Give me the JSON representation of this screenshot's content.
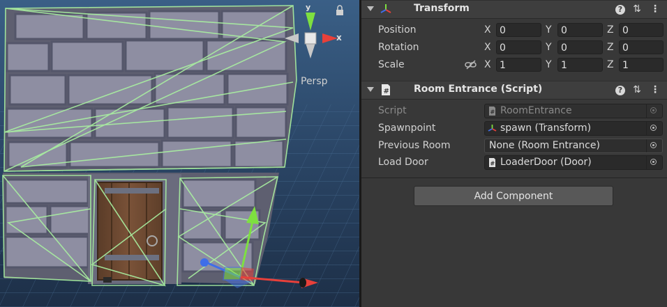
{
  "scene_view": {
    "persp_label": "Persp",
    "gizmo_x_label": "x",
    "gizmo_y_label": "y"
  },
  "transform": {
    "title": "Transform",
    "icon": "transform-axes-icon",
    "position_label": "Position",
    "rotation_label": "Rotation",
    "scale_label": "Scale",
    "axis_x": "X",
    "axis_y": "Y",
    "axis_z": "Z",
    "position": {
      "x": "0",
      "y": "0",
      "z": "0"
    },
    "rotation": {
      "x": "0",
      "y": "0",
      "z": "0"
    },
    "scale": {
      "x": "1",
      "y": "1",
      "z": "1"
    }
  },
  "room_entrance": {
    "title": "Room Entrance (Script)",
    "icon": "script-icon",
    "fields": {
      "script_label": "Script",
      "script_value": "RoomEntrance",
      "spawnpoint_label": "Spawnpoint",
      "spawnpoint_value": "spawn (Transform)",
      "previous_room_label": "Previous Room",
      "previous_room_value": "None (Room Entrance)",
      "load_door_label": "Load Door",
      "load_door_value": "LoaderDoor (Door)"
    }
  },
  "add_component_label": "Add Component",
  "colors": {
    "inspector_bg": "#383838",
    "header_bg": "#3e3e3e",
    "field_bg": "#2a2a2a",
    "axis_x": "#e8403a",
    "axis_y": "#7ee040",
    "axis_z": "#3f6ee8",
    "wireframe": "#a9f0a0"
  }
}
